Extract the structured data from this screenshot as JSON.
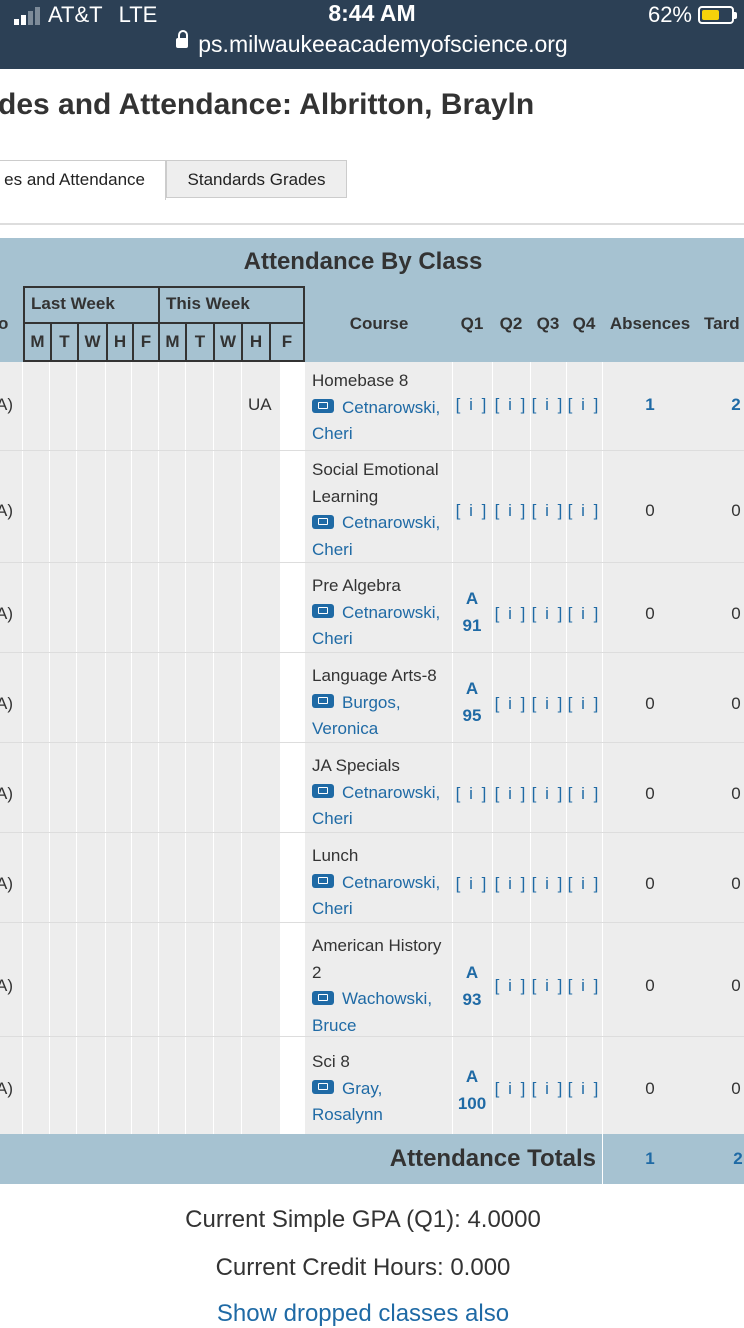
{
  "status_bar": {
    "carrier": "AT&T",
    "network": "LTE",
    "time": "8:44 AM",
    "battery": "62%"
  },
  "browser": {
    "url": "ps.milwaukeeacademyofscience.org"
  },
  "page": {
    "title": "des and Attendance: Albritton, Brayln",
    "tabs": [
      {
        "label": "es and Attendance"
      },
      {
        "label": "Standards Grades"
      }
    ]
  },
  "table": {
    "title": "Attendance By Class",
    "partial_left_header": "o",
    "last_week_label": "Last Week",
    "this_week_label": "This Week",
    "days": [
      "M",
      "T",
      "W",
      "H",
      "F",
      "M",
      "T",
      "W",
      "H",
      "F"
    ],
    "columns": {
      "course": "Course",
      "q1": "Q1",
      "q2": "Q2",
      "q3": "Q3",
      "q4": "Q4",
      "absences": "Absences",
      "tardies": "Tard"
    },
    "rows": [
      {
        "left": "A)",
        "attendance": "UA",
        "course": "Homebase 8",
        "teacher": "Cetnarowski, Cheri",
        "q1_grade": "",
        "q1_score": "",
        "q1": "[ i ]",
        "q2": "[ i ]",
        "q3": "[ i ]",
        "q4": "[ i ]",
        "absences": "1",
        "tardies": "2"
      },
      {
        "left": "A)",
        "attendance": "",
        "course": "Social Emotional Learning",
        "teacher": "Cetnarowski, Cheri",
        "q1_grade": "",
        "q1_score": "",
        "q1": "[ i ]",
        "q2": "[ i ]",
        "q3": "[ i ]",
        "q4": "[ i ]",
        "absences": "0",
        "tardies": "0"
      },
      {
        "left": "A)",
        "attendance": "",
        "course": "Pre Algebra",
        "teacher": "Cetnarowski, Cheri",
        "q1_grade": "A",
        "q1_score": "91",
        "q1": "",
        "q2": "[ i ]",
        "q3": "[ i ]",
        "q4": "[ i ]",
        "absences": "0",
        "tardies": "0"
      },
      {
        "left": "A)",
        "attendance": "",
        "course": "Language Arts-8",
        "teacher": "Burgos, Veronica",
        "q1_grade": "A",
        "q1_score": "95",
        "q1": "",
        "q2": "[ i ]",
        "q3": "[ i ]",
        "q4": "[ i ]",
        "absences": "0",
        "tardies": "0"
      },
      {
        "left": "A)",
        "attendance": "",
        "course": "JA Specials",
        "teacher": "Cetnarowski, Cheri",
        "q1_grade": "",
        "q1_score": "",
        "q1": "[ i ]",
        "q2": "[ i ]",
        "q3": "[ i ]",
        "q4": "[ i ]",
        "absences": "0",
        "tardies": "0"
      },
      {
        "left": "A)",
        "attendance": "",
        "course": "Lunch",
        "teacher": "Cetnarowski, Cheri",
        "q1_grade": "",
        "q1_score": "",
        "q1": "[ i ]",
        "q2": "[ i ]",
        "q3": "[ i ]",
        "q4": "[ i ]",
        "absences": "0",
        "tardies": "0"
      },
      {
        "left": "A)",
        "attendance": "",
        "course": "American History 2",
        "teacher": "Wachowski, Bruce",
        "q1_grade": "A",
        "q1_score": "93",
        "q1": "",
        "q2": "[ i ]",
        "q3": "[ i ]",
        "q4": "[ i ]",
        "absences": "0",
        "tardies": "0"
      },
      {
        "left": "A)",
        "attendance": "",
        "course": "Sci 8",
        "teacher": "Gray, Rosalynn",
        "q1_grade": "A",
        "q1_score": "100",
        "q1": "",
        "q2": "[ i ]",
        "q3": "[ i ]",
        "q4": "[ i ]",
        "absences": "0",
        "tardies": "0"
      }
    ],
    "totals": {
      "label": "Attendance Totals",
      "absences": "1",
      "tardies": "2"
    }
  },
  "summary": {
    "gpa": "Current Simple GPA (Q1): 4.0000",
    "credit_hours": "Current Credit Hours:  0.000",
    "dropped_link": "Show dropped classes also"
  },
  "colors": {
    "header_band": "#a6c2d1",
    "link": "#1f6aa5",
    "status_bar": "#2c4055"
  }
}
